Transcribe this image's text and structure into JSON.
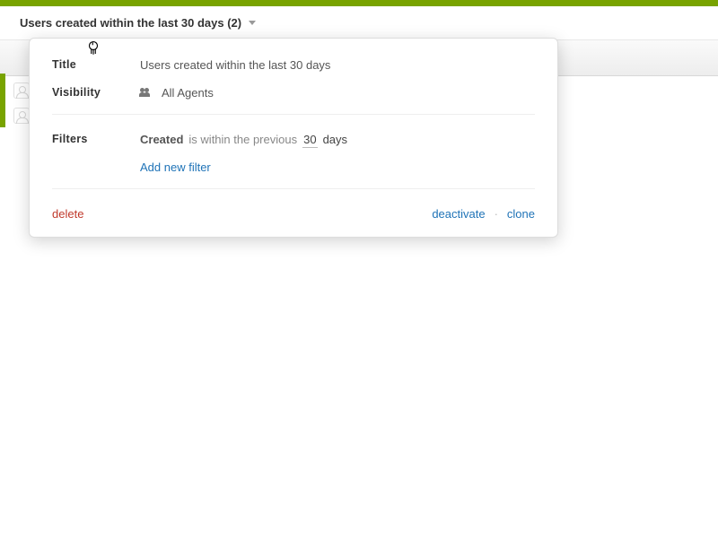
{
  "header": {
    "title": "Users created within the last 30 days (2)"
  },
  "panel": {
    "labels": {
      "title": "Title",
      "visibility": "Visibility",
      "filters": "Filters"
    },
    "title_value": "Users created within the last 30 days",
    "visibility_value": "All Agents",
    "filter": {
      "field": "Created",
      "operator": "is within the previous",
      "value": "30",
      "unit": "days"
    },
    "add_filter": "Add new filter",
    "actions": {
      "delete": "delete",
      "deactivate": "deactivate",
      "clone": "clone"
    }
  }
}
